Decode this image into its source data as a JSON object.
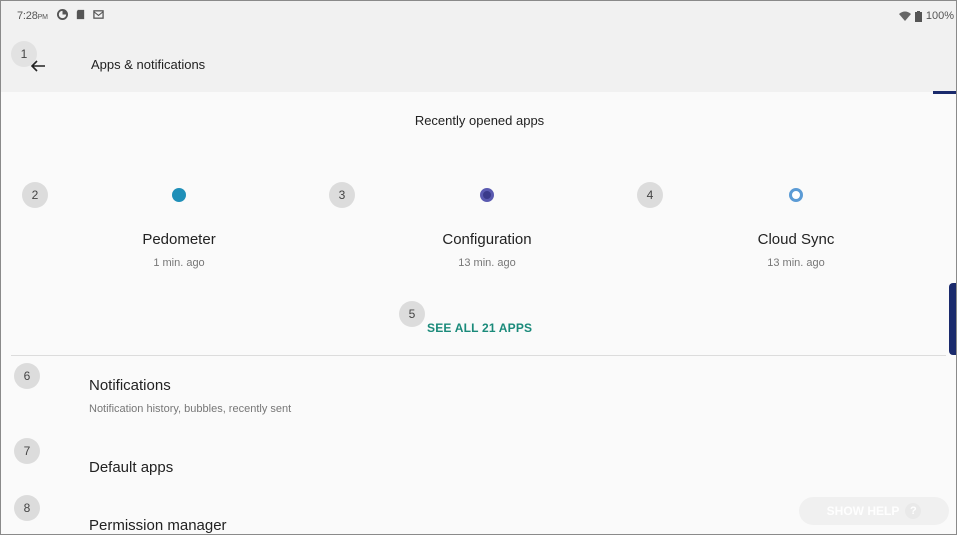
{
  "status_bar": {
    "time": "7:28",
    "ampm": "PM",
    "battery": "100%",
    "icons": [
      "sync-icon",
      "sd-card-icon",
      "mail-icon"
    ]
  },
  "app_bar": {
    "title": "Apps & notifications",
    "back_icon": "arrow-back-icon"
  },
  "recent": {
    "section_title": "Recently opened apps",
    "apps": [
      {
        "name": "Pedometer",
        "time": "1 min. ago",
        "icon": "pedometer-icon",
        "color": "#1f8fb8"
      },
      {
        "name": "Configuration",
        "time": "13 min. ago",
        "icon": "configuration-icon",
        "color": "#3a3a8a"
      },
      {
        "name": "Cloud Sync",
        "time": "13 min. ago",
        "icon": "cloud-sync-icon",
        "color": "#5b9bd5"
      }
    ],
    "see_all": "SEE ALL 21 APPS"
  },
  "list": [
    {
      "title": "Notifications",
      "subtitle": "Notification history, bubbles, recently sent"
    },
    {
      "title": "Default apps",
      "subtitle": ""
    },
    {
      "title": "Permission manager",
      "subtitle": ""
    }
  ],
  "badges": [
    "1",
    "2",
    "3",
    "4",
    "5",
    "6",
    "7",
    "8"
  ],
  "help_button": "SHOW HELP",
  "colors": {
    "accent": "#1a8a7a",
    "indicator": "#1a2a6c"
  }
}
